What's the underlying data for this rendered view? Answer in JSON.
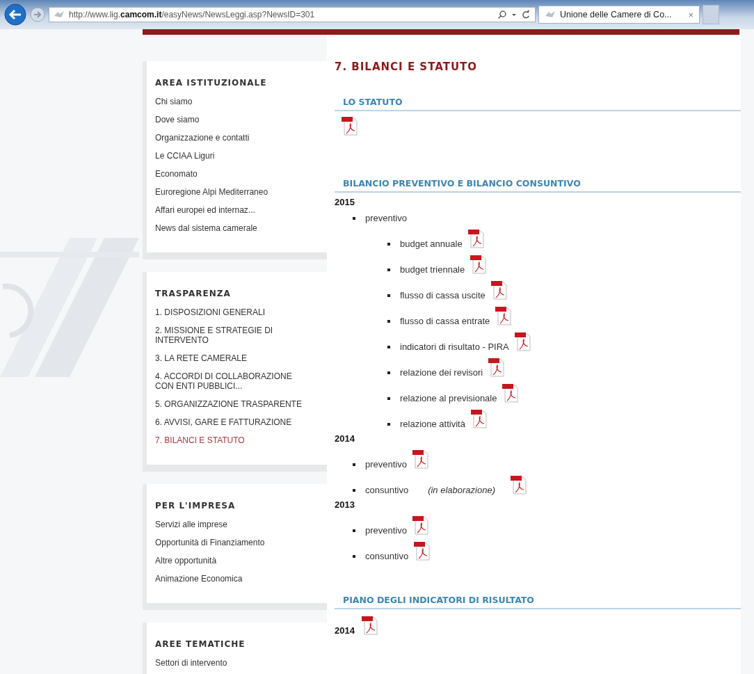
{
  "browser": {
    "url": "http://www.lig.**camcom.it**/easyNews/NewsLeggi.asp?NewsID=301",
    "tab": {
      "title": "Unione delle Camere di Co...",
      "close": "×",
      "selected": true
    }
  },
  "sidebar": [
    {
      "title": "AREA ISTITUZIONALE",
      "items": [
        {
          "label": "Chi siamo",
          "selected": false
        },
        {
          "label": "Dove siamo",
          "selected": false
        },
        {
          "label": "Organizzazione e contatti",
          "selected": false
        },
        {
          "label": "Le CCIAA Liguri",
          "selected": false
        },
        {
          "label": "Economato",
          "selected": false
        },
        {
          "label": "Euroregione Alpi Mediterraneo",
          "selected": false
        },
        {
          "label": "Affari europei ed internaz...",
          "selected": false
        },
        {
          "label": "News dal sistema camerale",
          "selected": false
        }
      ]
    },
    {
      "title": "TRASPARENZA",
      "items": [
        {
          "label": "1. DISPOSIZIONI GENERALI",
          "selected": false
        },
        {
          "label": "2. MISSIONE E STRATEGIE DI INTERVENTO",
          "selected": false
        },
        {
          "label": "3. LA RETE CAMERALE",
          "selected": false
        },
        {
          "label": "4. ACCORDI DI COLLABORAZIONE CON ENTI PUBBLICI...",
          "selected": false
        },
        {
          "label": "5. ORGANIZZAZIONE TRASPARENTE",
          "selected": false
        },
        {
          "label": "6. AVVISI, GARE E FATTURAZIONE",
          "selected": false
        },
        {
          "label": "7. BILANCI E STATUTO",
          "selected": true
        }
      ]
    },
    {
      "title": "PER L'IMPRESA",
      "items": [
        {
          "label": "Servizi alle imprese",
          "selected": false
        },
        {
          "label": "Opportunità di Finanziamento",
          "selected": false
        },
        {
          "label": "Altre opportunità",
          "selected": false
        },
        {
          "label": "Animazione Economica",
          "selected": false
        }
      ]
    },
    {
      "title": "AREE TEMATICHE",
      "items": [
        {
          "label": "Settori di intervento",
          "selected": false
        }
      ]
    }
  ],
  "main": {
    "title": "7. BILANCI E STATUTO",
    "sections": [
      {
        "heading": "LO STATUTO",
        "content": [
          {
            "kind": "pdf"
          }
        ]
      },
      {
        "heading": "BILANCIO PREVENTIVO E BILANCIO CONSUNTIVO",
        "content": [
          {
            "kind": "year",
            "label": "2015",
            "items": [
              {
                "label": "preventivo",
                "pdf": false,
                "children": [
                  {
                    "label": "budget annuale",
                    "pdf": true
                  },
                  {
                    "label": "budget triennale",
                    "pdf": true
                  },
                  {
                    "label": "flusso di cassa uscite",
                    "pdf": true
                  },
                  {
                    "label": "flusso di cassa entrate",
                    "pdf": true
                  },
                  {
                    "label": "indicatori di risultato - PIRA",
                    "pdf": true
                  },
                  {
                    "label": "relazione dei revisori",
                    "pdf": true
                  },
                  {
                    "label": "relazione al previsionale",
                    "pdf": true
                  },
                  {
                    "label": "relazione attività",
                    "pdf": true
                  }
                ]
              }
            ]
          },
          {
            "kind": "year",
            "label": "2014",
            "items": [
              {
                "label": "preventivo",
                "pdf": true
              },
              {
                "label": "consuntivo",
                "note": "(in elaborazione)",
                "pdf": true
              }
            ]
          },
          {
            "kind": "year",
            "label": "2013",
            "items": [
              {
                "label": "preventivo",
                "pdf": true
              },
              {
                "label": "consuntivo",
                "pdf": true
              }
            ]
          }
        ]
      },
      {
        "heading": "PIANO DEGLI INDICATORI DI RISULTATO",
        "content": [
          {
            "kind": "year_pdf",
            "label": "2014"
          }
        ]
      }
    ]
  }
}
